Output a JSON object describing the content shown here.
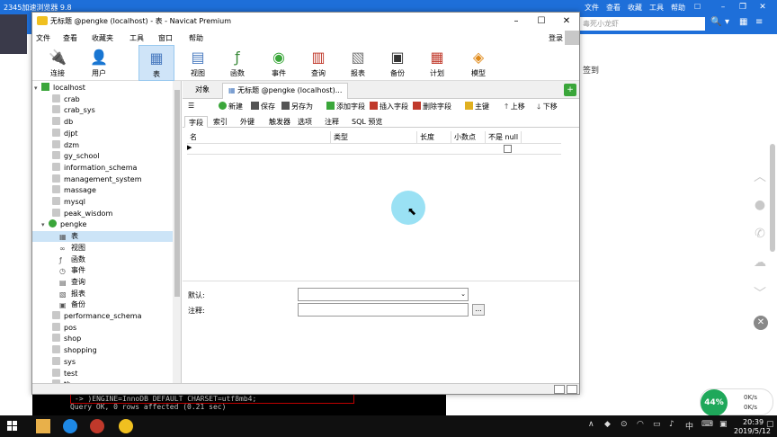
{
  "browser": {
    "title": "2345加速浏览器 9.8",
    "menu": [
      "文件",
      "查看",
      "收藏",
      "工具",
      "帮助"
    ],
    "search_placeholder": "毒死小龙虾",
    "sign_text": "签到"
  },
  "console": {
    "line1": "  -> )ENGINE=InnoDB DEFAULT CHARSET=utf8mb4;",
    "line2": "Query OK, 0 rows affected (0.21 sec)"
  },
  "speed": {
    "percent": "44%",
    "up": "0K/s",
    "down": "0K/s"
  },
  "window": {
    "title": "无标题 @pengke (localhost) - 表 - Navicat Premium",
    "menu": [
      "文件",
      "查看",
      "收藏夹",
      "工具",
      "窗口",
      "帮助"
    ],
    "login": "登录",
    "toolbar": [
      {
        "label": "连接",
        "icon": "plug-icon"
      },
      {
        "label": "用户",
        "icon": "user-icon"
      },
      {
        "label": "表",
        "icon": "table-icon"
      },
      {
        "label": "视图",
        "icon": "view-icon"
      },
      {
        "label": "函数",
        "icon": "function-icon"
      },
      {
        "label": "事件",
        "icon": "event-icon"
      },
      {
        "label": "查询",
        "icon": "query-icon"
      },
      {
        "label": "报表",
        "icon": "report-icon"
      },
      {
        "label": "备份",
        "icon": "backup-icon"
      },
      {
        "label": "计划",
        "icon": "schedule-icon"
      },
      {
        "label": "模型",
        "icon": "model-icon"
      }
    ]
  },
  "tree": {
    "connection": "localhost",
    "databases_before": [
      "crab",
      "crab_sys",
      "db",
      "djpt",
      "dzm",
      "gy_school",
      "information_schema",
      "management_system",
      "massage",
      "mysql",
      "peak_wisdom"
    ],
    "open_db": "pengke",
    "open_children": [
      "表",
      "视图",
      "函数",
      "事件",
      "查询",
      "报表",
      "备份"
    ],
    "databases_after": [
      "performance_schema",
      "pos",
      "shop",
      "shopping",
      "sys",
      "test",
      "th"
    ]
  },
  "tabs": {
    "objects": "对象",
    "designer": "无标题 @pengke (localhost)..."
  },
  "subtoolbar": [
    "新建",
    "保存",
    "另存为",
    "添加字段",
    "插入字段",
    "删除字段",
    "主键",
    "上移",
    "下移"
  ],
  "field_tabs": [
    "字段",
    "索引",
    "外键",
    "触发器",
    "选项",
    "注释",
    "SQL 预览"
  ],
  "grid": {
    "headers": [
      "名",
      "类型",
      "长度",
      "小数点",
      "不是 null"
    ]
  },
  "props": {
    "default_label": "默认:",
    "comment_label": "注释:"
  },
  "taskbar": {
    "time": "20:39",
    "date": "2019/5/12",
    "ime": "中"
  }
}
